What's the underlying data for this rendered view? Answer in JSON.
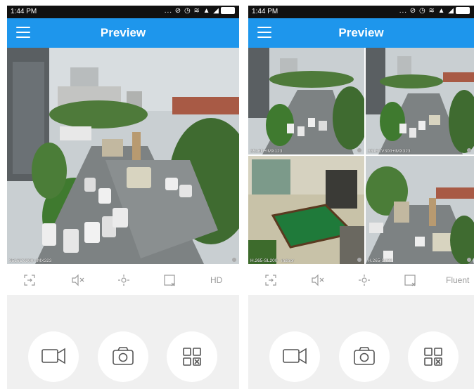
{
  "screens": [
    {
      "status_time": "1:44 PM",
      "status_icons": "... ⊘ ◷ ≋ ▲ ◢",
      "title": "Preview",
      "cameras": [
        {
          "label": "3516CV300+IMX323"
        }
      ],
      "toolbar": {
        "quality_label": "HD"
      },
      "icons": {
        "menu": "menu-icon",
        "fullscreen": "fullscreen-icon",
        "mute": "speaker-mute-icon",
        "ptz": "ptz-icon",
        "close_window": "close-window-icon",
        "record": "video-record-icon",
        "snapshot": "camera-snapshot-icon",
        "multiview": "grid-view-icon"
      }
    },
    {
      "status_time": "1:44 PM",
      "status_icons": "... ⊘ ◷ ≋ ▲ ◢",
      "title": "Preview",
      "cameras": [
        {
          "label": "3516D+IMX123"
        },
        {
          "label": "3516CV300+IMX323"
        },
        {
          "label": "H.265-SL200 - indoor"
        },
        {
          "label": "H.265-S400"
        }
      ],
      "toolbar": {
        "quality_label": "Fluent"
      },
      "icons": {
        "menu": "menu-icon",
        "fullscreen": "fullscreen-icon",
        "mute": "speaker-mute-icon",
        "ptz": "ptz-icon",
        "close_window": "close-window-icon",
        "record": "video-record-icon",
        "snapshot": "camera-snapshot-icon",
        "multiview": "grid-view-icon"
      }
    }
  ],
  "colors": {
    "appbar": "#1e96ec",
    "statusbar": "#111111",
    "background": "#f0f0f0",
    "icon_gray": "#9a9a9a"
  }
}
